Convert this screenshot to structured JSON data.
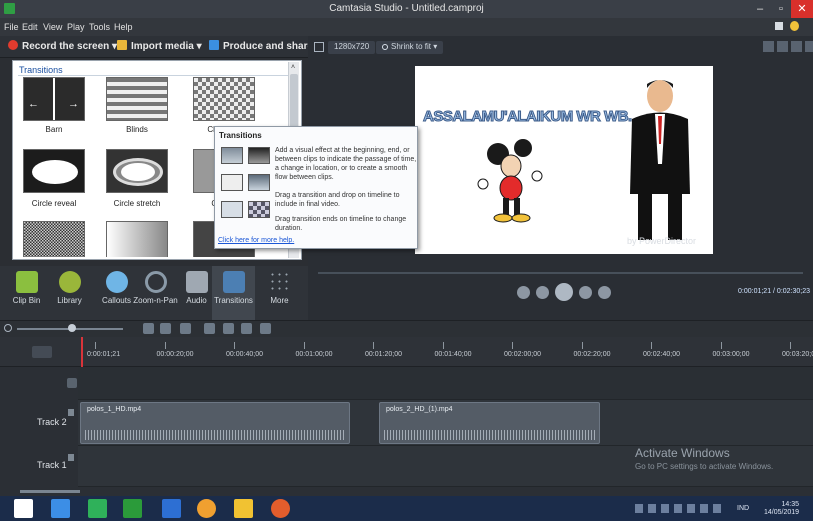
{
  "window": {
    "title": "Camtasia Studio - Untitled.camproj",
    "minimize": "–",
    "maximize": "▫",
    "close": "✕"
  },
  "menu": [
    "File",
    "Edit",
    "View",
    "Play",
    "Tools",
    "Help"
  ],
  "toolbar": {
    "record": "Record the screen ▾",
    "import": "Import media ▾",
    "produce": "Produce and share ▾"
  },
  "preview": {
    "dimensions": "1280x720",
    "zoom": "Shrink to fit ▾"
  },
  "transitions": {
    "header": "Transitions",
    "items": [
      {
        "label": "Barn"
      },
      {
        "label": "Blinds"
      },
      {
        "label": "Chec"
      },
      {
        "label": "Circle reveal"
      },
      {
        "label": "Circle stretch"
      },
      {
        "label": "Cub"
      }
    ]
  },
  "tooltip": {
    "title": "Transitions",
    "para1": "Add a visual effect at the beginning, end, or between clips to indicate the passage of time, a change in location, or to create a smooth flow between clips.",
    "para2": "Drag a transition and drop on timeline to include in final video.",
    "para3": "Drag transition ends on timeline to change duration.",
    "link": "Click here for more help."
  },
  "canvas": {
    "headline": "ASSALAMU'ALAIKUM WR WB.",
    "brand": "by PowerDirector"
  },
  "tabs": [
    {
      "label": "Clip Bin",
      "color": "#8bbf3f"
    },
    {
      "label": "Library",
      "color": "#9ab63a"
    },
    {
      "label": "Callouts",
      "color": "#6fb5e6"
    },
    {
      "label": "Zoom-n-Pan",
      "color": "#8a9aa8"
    },
    {
      "label": "Audio",
      "color": "#9fa8b2"
    },
    {
      "label": "Transitions",
      "color": "#4c7fb3"
    },
    {
      "label": "More",
      "color": "#6c7682"
    }
  ],
  "playback": {
    "timecode": "0:00:01;21 / 0:02:30;23"
  },
  "ruler": {
    "ticks": [
      "0:00:01;21",
      "00:00:20;00",
      "00:00:40;00",
      "00:01:00;00",
      "00:01:20;00",
      "00:01:40;00",
      "00:02:00;00",
      "00:02:20;00",
      "00:02:40;00",
      "00:03:00;00",
      "00:03:20;00"
    ]
  },
  "tracks": [
    {
      "name": "Track 2"
    },
    {
      "name": "Track 1"
    }
  ],
  "clips": [
    {
      "name": "polos_1_HD.mp4"
    },
    {
      "name": "polos_2_HD_(1).mp4"
    }
  ],
  "watermark": {
    "line1": "Activate Windows",
    "line2": "Go to PC settings to activate Windows."
  },
  "taskbar": {
    "lang": "IND",
    "time": "14:35",
    "date": "14/05/2019",
    "colors": [
      "#ffffff",
      "#3c8ee6",
      "#2fb15a",
      "#2b9b3a",
      "#2d6fd3",
      "#f0a030",
      "#f1c232",
      "#e35d2c"
    ]
  }
}
